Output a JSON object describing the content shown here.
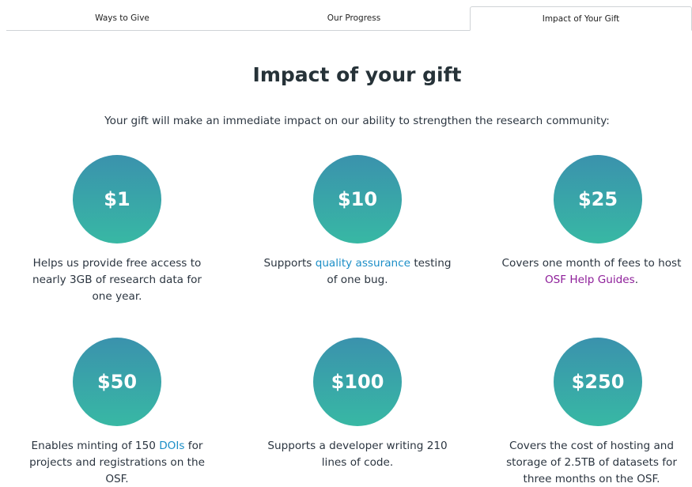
{
  "tabs": [
    {
      "label": "Ways to Give"
    },
    {
      "label": "Our Progress"
    },
    {
      "label": "Impact of Your Gift"
    }
  ],
  "heading": "Impact of your gift",
  "intro": "Your gift will make an immediate impact on our ability to strengthen the research community:",
  "colors": {
    "circle_top": "#3a92ad",
    "circle_bottom": "#38b8a4",
    "link": "#1b8ec7",
    "visited_link": "#8e1f9a"
  },
  "items": [
    {
      "amount": "$1",
      "lines": [
        "Helps us provide free access to",
        "nearly 3GB of research data for",
        "one year."
      ]
    },
    {
      "amount": "$10",
      "pre": "Supports ",
      "link": "quality assurance",
      "post": " testing",
      "line2": "of one bug."
    },
    {
      "amount": "$25",
      "line1": "Covers one month of fees to host",
      "link": "OSF Help Guides",
      "post": "."
    },
    {
      "amount": "$50",
      "pre": "Enables minting of 150 ",
      "link": "DOIs",
      "post": " for",
      "line2": "projects and registrations on the",
      "line3": "OSF."
    },
    {
      "amount": "$100",
      "lines": [
        "Supports a developer writing 210",
        "lines of code."
      ]
    },
    {
      "amount": "$250",
      "lines": [
        "Covers the cost of hosting and",
        "storage of 2.5TB of datasets for",
        "three months on the OSF."
      ]
    }
  ]
}
